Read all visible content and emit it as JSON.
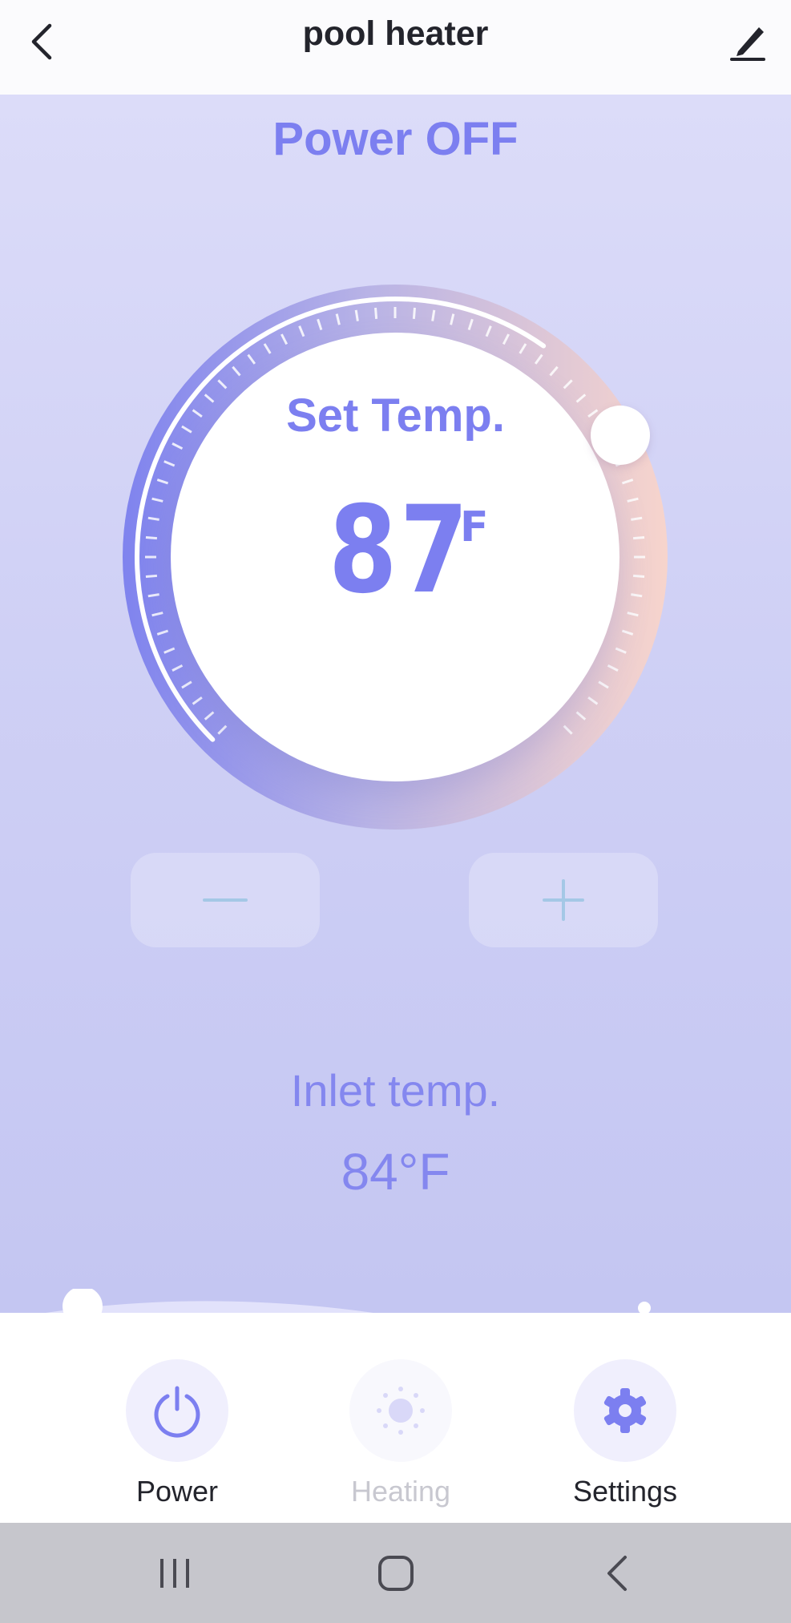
{
  "header": {
    "title": "pool heater",
    "back_icon": "chevron-left-icon",
    "edit_icon": "pencil-icon"
  },
  "status": {
    "power_text": "Power OFF"
  },
  "thermostat": {
    "set_label": "Set Temp.",
    "set_value": "87",
    "unit": "°F",
    "level_fraction": 0.63
  },
  "controls": {
    "decrease_icon": "minus-icon",
    "increase_icon": "plus-icon"
  },
  "inlet": {
    "label": "Inlet temp.",
    "value": "84°F"
  },
  "bottom_nav": {
    "items": [
      {
        "label": "Power",
        "icon": "power-icon",
        "active": true
      },
      {
        "label": "Heating",
        "icon": "sun-icon",
        "active": false
      },
      {
        "label": "Settings",
        "icon": "gear-icon",
        "active": true
      }
    ]
  },
  "system_nav": {
    "recents_icon": "recents-icon",
    "home_icon": "home-icon",
    "back_icon": "back-icon"
  },
  "colors": {
    "accent": "#7c7ff0",
    "background_top": "#dcdcf9",
    "background_bottom": "#c4c6f2",
    "text_dark": "#23242c",
    "disabled": "#c8c8d0",
    "system_bar": "#c6c6cc"
  }
}
